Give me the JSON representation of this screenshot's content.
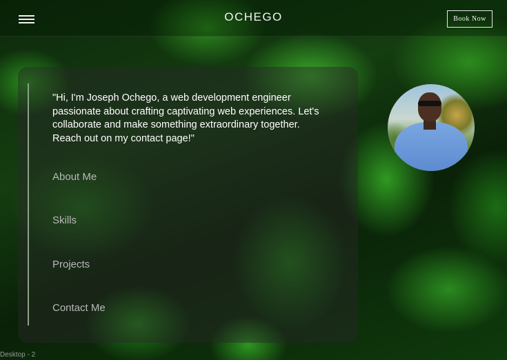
{
  "header": {
    "brand": "OCHEGO",
    "book_button_label": "Book Now",
    "menu_icon": "hamburger-menu-icon"
  },
  "main": {
    "intro": "\"Hi, I'm Joseph Ochego, a web development engineer passionate about crafting captivating web experiences. Let's collaborate and make something extraordinary together. Reach out on my contact page!\"",
    "nav": [
      {
        "label": "About Me"
      },
      {
        "label": "Skills"
      },
      {
        "label": "Projects"
      },
      {
        "label": "Contact Me"
      }
    ],
    "avatar_icon": "profile-photo"
  },
  "frame": {
    "label": "Desktop - 2"
  },
  "colors": {
    "accent_text": "#ffffff",
    "nav_text": "#b8b8b8",
    "background": "#0e2a0c"
  }
}
